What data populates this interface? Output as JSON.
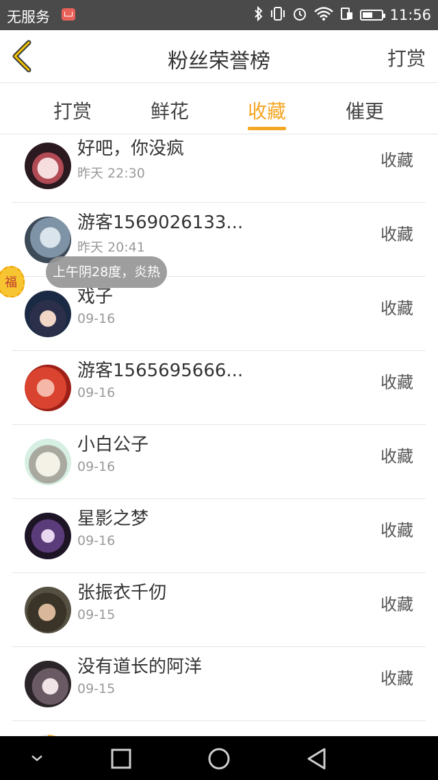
{
  "status_bar": {
    "carrier": "无服务",
    "time": "11:56"
  },
  "header": {
    "title": "粉丝荣誉榜",
    "right_action": "打赏"
  },
  "tabs": [
    {
      "label": "打赏"
    },
    {
      "label": "鲜花"
    },
    {
      "label": "收藏",
      "active": true
    },
    {
      "label": "催更"
    }
  ],
  "rows": [
    {
      "name": "好吧，你没疯",
      "date": "昨天 22:30",
      "action": "收藏"
    },
    {
      "name": "游客1569026133...",
      "date": "昨天 20:41",
      "action": "收藏"
    },
    {
      "name": "戏子",
      "date": "09-16",
      "action": "收藏"
    },
    {
      "name": "游客1565695666...",
      "date": "09-16",
      "action": "收藏"
    },
    {
      "name": "小白公子",
      "date": "09-16",
      "action": "收藏"
    },
    {
      "name": "星影之梦",
      "date": "09-16",
      "action": "收藏"
    },
    {
      "name": "张振衣千仞",
      "date": "09-15",
      "action": "收藏"
    },
    {
      "name": "没有道长的阿洋",
      "date": "09-15",
      "action": "收藏"
    }
  ],
  "overlay": {
    "weather_tip": "上午阴28度，炎热",
    "fu_badge": "福"
  },
  "colors": {
    "accent": "#f5a623",
    "status_bar_bg": "#4a4a4a"
  }
}
